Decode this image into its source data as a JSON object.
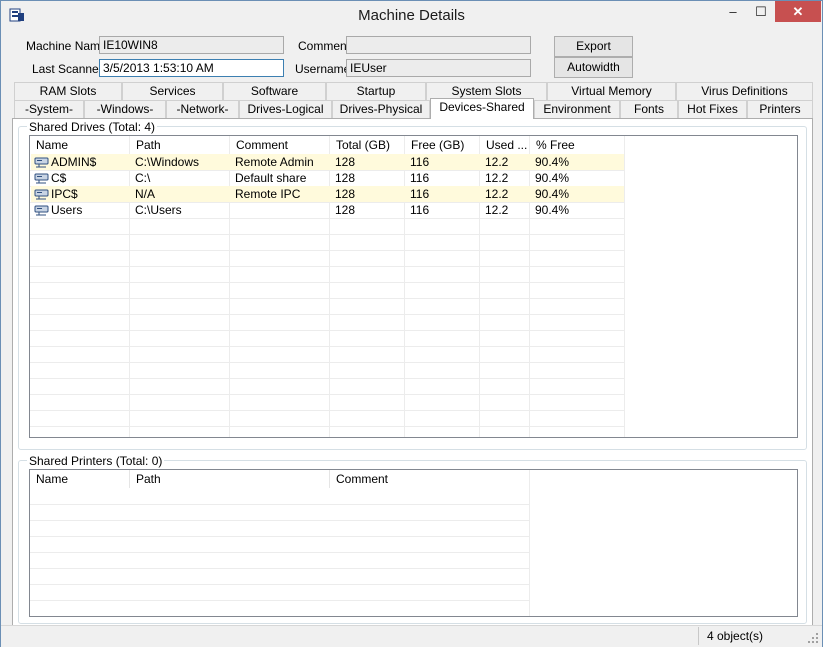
{
  "window": {
    "title": "Machine Details",
    "minimize": "–",
    "maximize": "☐",
    "close": "✕"
  },
  "form": {
    "machine_name_label": "Machine Name",
    "machine_name_value": "IE10WIN8",
    "comment_label": "Comment",
    "comment_value": "",
    "last_scanned_label": "Last Scanned",
    "last_scanned_value": "3/5/2013 1:53:10 AM",
    "username_label": "Username",
    "username_value": "IEUser",
    "export_label": "Export",
    "autowidth_label": "Autowidth"
  },
  "tabs_top": [
    "RAM Slots",
    "Services",
    "Software",
    "Startup",
    "System Slots",
    "Virtual Memory",
    "Virus Definitions"
  ],
  "tabs_bottom": [
    "-System-",
    "-Windows-",
    "-Network-",
    "Drives-Logical",
    "Drives-Physical",
    "Devices-Shared",
    "Environment",
    "Fonts",
    "Hot Fixes",
    "Printers"
  ],
  "active_tab": "Devices-Shared",
  "shared_drives": {
    "title": "Shared Drives (Total: 4)",
    "columns": [
      "Name",
      "Path",
      "Comment",
      "Total (GB)",
      "Free (GB)",
      "Used ...",
      "% Free"
    ],
    "rows": [
      [
        "ADMIN$",
        "C:\\Windows",
        "Remote Admin",
        "128",
        "116",
        "12.2",
        "90.4%"
      ],
      [
        "C$",
        "C:\\",
        "Default share",
        "128",
        "116",
        "12.2",
        "90.4%"
      ],
      [
        "IPC$",
        "N/A",
        "Remote IPC",
        "128",
        "116",
        "12.2",
        "90.4%"
      ],
      [
        "Users",
        "C:\\Users",
        "",
        "128",
        "116",
        "12.2",
        "90.4%"
      ]
    ]
  },
  "shared_printers": {
    "title": "Shared Printers (Total: 0)",
    "columns": [
      "Name",
      "Path",
      "Comment"
    ]
  },
  "status": {
    "objects": "4 object(s)"
  },
  "colors": {
    "alt_row": "#fffadc",
    "close_button": "#c75050"
  }
}
